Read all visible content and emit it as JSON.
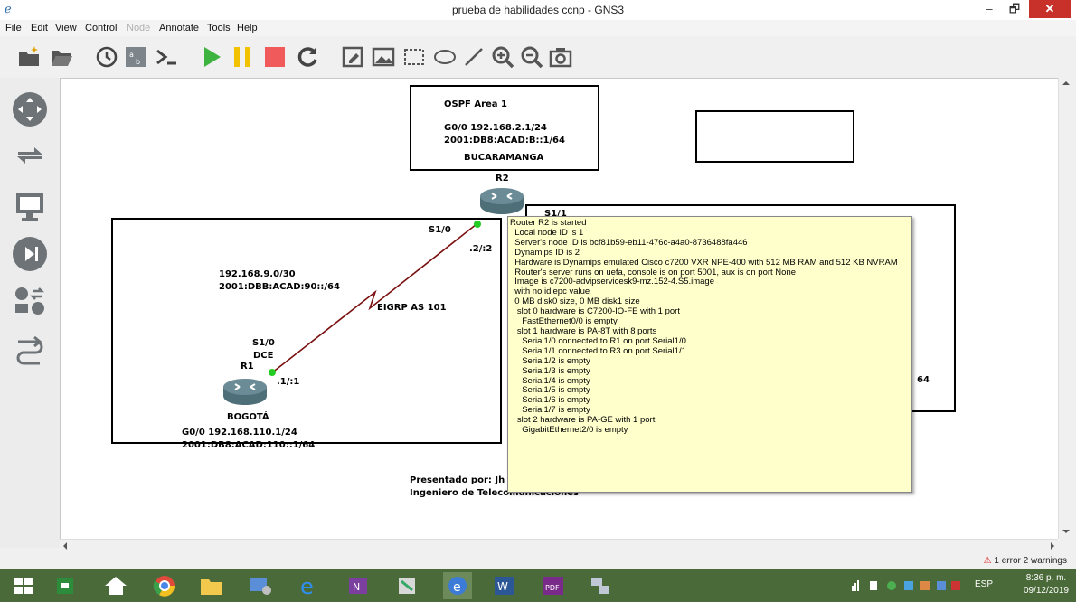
{
  "window": {
    "title": "prueba de habilidades ccnp - GNS3",
    "min_symbol": "–",
    "max_symbol": "🗗",
    "close_symbol": "✕"
  },
  "menu": [
    {
      "label": "File",
      "enabled": true
    },
    {
      "label": "Edit",
      "enabled": true
    },
    {
      "label": "View",
      "enabled": true
    },
    {
      "label": "Control",
      "enabled": true
    },
    {
      "label": "Node",
      "enabled": false
    },
    {
      "label": "Annotate",
      "enabled": true
    },
    {
      "label": "Tools",
      "enabled": true
    },
    {
      "label": "Help",
      "enabled": true
    }
  ],
  "toolbar_icons": [
    "new-project-icon",
    "open-project-icon",
    "snapshot-clock-icon",
    "show-interface-labels-icon",
    "console-icon",
    "start-icon",
    "pause-icon",
    "stop-icon",
    "reload-icon",
    "add-note-icon",
    "insert-picture-icon",
    "draw-rectangle-icon",
    "draw-ellipse-icon",
    "draw-line-icon",
    "zoom-in-icon",
    "zoom-out-icon",
    "screenshot-icon"
  ],
  "dock_icons": [
    "routers-icon",
    "switches-icon",
    "end-devices-icon",
    "security-devices-icon",
    "all-devices-icon",
    "add-link-icon"
  ],
  "topology": {
    "r2_box": {
      "area": "OSPF Area 1",
      "ip4": "G0/0 192.168.2.1/24",
      "ip6": "2001:DB8:ACAD:B::1/64",
      "city": "BUCARAMANGA"
    },
    "r2_name": "R2",
    "r2_if_s10": "S1/0",
    "r2_addr_s10": ".2/:2",
    "r2_if_s11": "S1/1",
    "left_network": {
      "net4": "192.168.9.0/30",
      "net6": "2001:DBB:ACAD:90::/64",
      "protocol": "EIGRP AS 101"
    },
    "r1_if": "S1/0",
    "r1_dce": "DCE",
    "r1_name": "R1",
    "r1_addr": ".1/:1",
    "r1_box": {
      "city": "BOGOTÁ",
      "ip4": "G0/0 192.168.110.1/24",
      "ip6": "2001:DB8:ACAD:110::1/64"
    },
    "right_partial": "64",
    "footer": {
      "line1": "Presentado por: Jh",
      "line2": "Ingeniero de Telecomunicaciones"
    }
  },
  "tooltip": [
    "Router R2 is started",
    "  Local node ID is 1",
    "  Server's node ID is bcf81b59-eb11-476c-a4a0-8736488fa446",
    "  Dynamips ID is 2",
    "  Hardware is Dynamips emulated Cisco c7200 VXR NPE-400 with 512 MB RAM and 512 KB NVRAM",
    "  Router's server runs on uefa, console is on port 5001, aux is on port None",
    "  Image is c7200-advipservicesk9-mz.152-4.S5.image",
    "  with no idlepc value",
    "  0 MB disk0 size, 0 MB disk1 size",
    "   slot 0 hardware is C7200-IO-FE with 1 port",
    "     FastEthernet0/0 is empty",
    "   slot 1 hardware is PA-8T with 8 ports",
    "     Serial1/0 connected to R1 on port Serial1/0",
    "     Serial1/1 connected to R3 on port Serial1/1",
    "     Serial1/2 is empty",
    "     Serial1/3 is empty",
    "     Serial1/4 is empty",
    "     Serial1/5 is empty",
    "     Serial1/6 is empty",
    "     Serial1/7 is empty",
    "   slot 2 hardware is PA-GE with 1 port",
    "     GigabitEthernet2/0 is empty"
  ],
  "status": {
    "errors": "1 error 2 warnings"
  },
  "taskbar": {
    "lang": "ESP",
    "time": "8:36 p. m.",
    "date": "09/12/2019"
  },
  "colors": {
    "link": "#7a1010",
    "port_up": "#22cc22",
    "router": "#5a7f8a",
    "tooltip_bg": "#ffffcc",
    "close_btn": "#c7312a"
  }
}
